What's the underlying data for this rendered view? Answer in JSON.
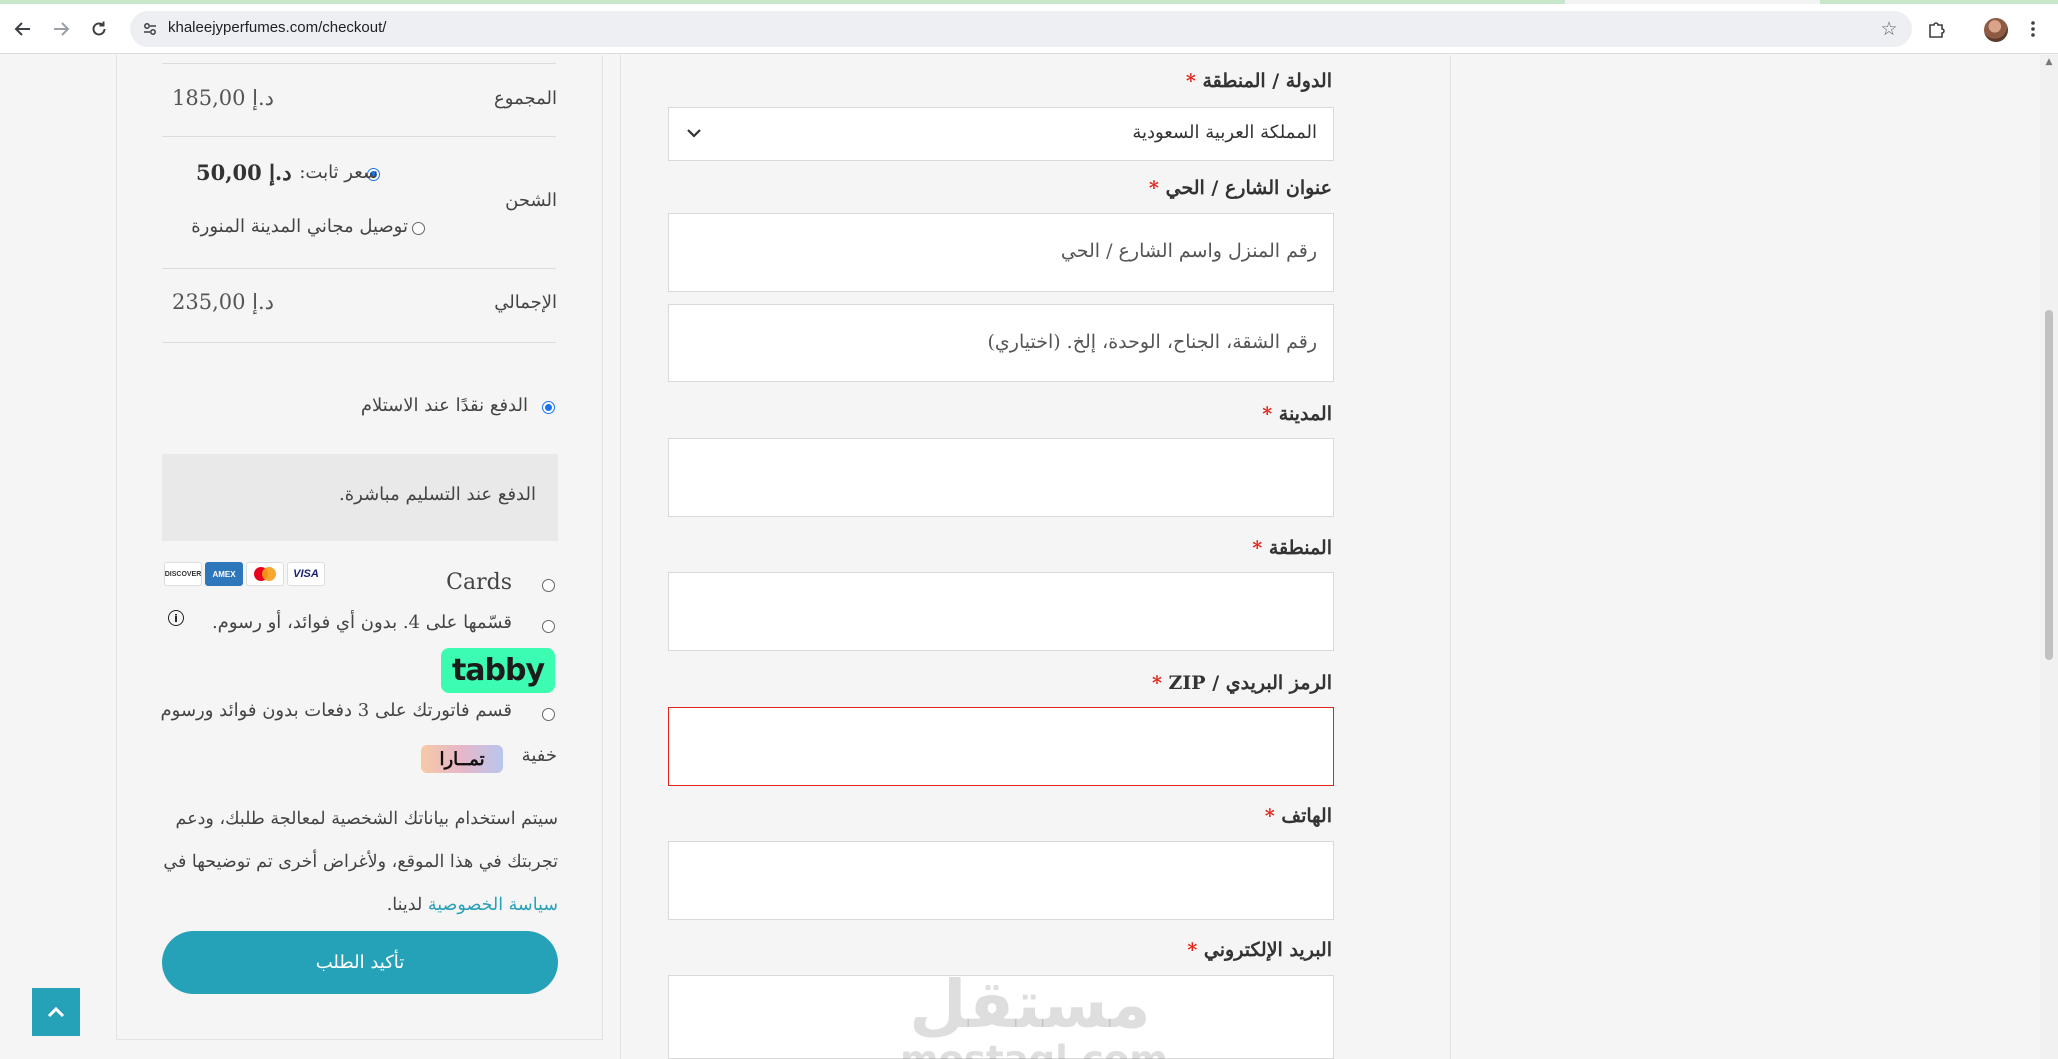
{
  "browser": {
    "url": "khaleejyperfumes.com/checkout/",
    "back_icon": "arrow-left-icon",
    "forward_icon": "arrow-right-icon",
    "reload_icon": "reload-icon",
    "site_info_icon": "tune-icon",
    "bookmark_icon": "star-icon",
    "extensions_icon": "puzzle-icon",
    "menu_icon": "kebab-menu-icon"
  },
  "order_summary": {
    "subtotal": {
      "label": "المجموع",
      "amount": "185,00 د.إ"
    },
    "shipping": {
      "label": "الشحن",
      "options": [
        {
          "label": "سعر ثابت:",
          "amount": "50,00 د.إ",
          "selected": true
        },
        {
          "label": "توصيل مجاني المدينة المنورة",
          "selected": false
        }
      ]
    },
    "total": {
      "label": "الإجمالي",
      "amount": "235,00 د.إ"
    }
  },
  "payment": {
    "cod": {
      "label": "الدفع نقدًا عند الاستلام",
      "selected": true,
      "description": "الدفع عند التسليم مباشرة."
    },
    "cards": {
      "label": "Cards",
      "logos": [
        "VISA",
        "mastercard",
        "AMEX",
        "DISCOVER"
      ]
    },
    "tabby": {
      "label": "قسّمها على 4. بدون أي فوائد، أو رسوم.",
      "logo": "tabby"
    },
    "tamara": {
      "label_line1": "قسم فاتورتك على 3 دفعات بدون فوائد ورسوم",
      "label_line2": "خفية",
      "logo": "تمــارا"
    }
  },
  "privacy": {
    "text_before": "سيتم استخدام بياناتك الشخصية لمعالجة طلبك، ودعم تجربتك في هذا الموقع، ولأغراض أخرى تم توضيحها في",
    "link": "سياسة الخصوصية",
    "text_after": "لدينا."
  },
  "place_order_label": "تأكيد الطلب",
  "form": {
    "country": {
      "label": "الدولة / المنطقة",
      "value": "المملكة العربية السعودية"
    },
    "street": {
      "label": "عنوان الشارع / الحي",
      "placeholder1": "رقم المنزل واسم الشارع / الحي",
      "placeholder2": "رقم الشقة، الجناح، الوحدة، إلخ. (اختياري)"
    },
    "city": {
      "label": "المدينة"
    },
    "region": {
      "label": "المنطقة"
    },
    "zip": {
      "label": "الرمز البريدي / ZIP"
    },
    "phone": {
      "label": "الهاتف"
    },
    "email": {
      "label": "البريد الإلكتروني"
    },
    "required_mark": "*"
  },
  "watermark": {
    "arabic": "مستقل",
    "latin": "mostaql.com"
  },
  "colors": {
    "accent": "#26a2b8",
    "required": "#e2231a",
    "tabby": "#3bfcb0"
  }
}
